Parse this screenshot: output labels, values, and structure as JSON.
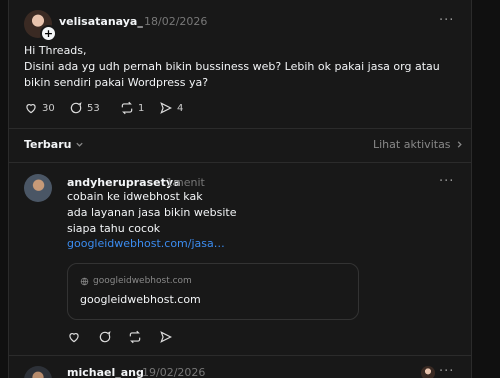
{
  "post": {
    "username": "velisatanaya_",
    "date": "18/02/2026",
    "text": "Hi Threads,\nDisini ada yg udh pernah bikin bussiness web? Lebih ok pakai jasa org atau bikin sendiri pakai Wordpress ya?",
    "likes": "30",
    "comments": "53",
    "reposts": "1",
    "shares": "4",
    "more_label": "···"
  },
  "replies_header": {
    "sort_label": "Terbaru",
    "activity_label": "Lihat aktivitas"
  },
  "reply1": {
    "username": "andyheruprasetya",
    "time": "1menit",
    "text": "cobain ke idwebhost kak\nada layanan jasa bikin website\nsiapa tahu cocok",
    "link": "googleidwebhost.com/jasa…",
    "preview_domain": "googleidwebhost.com",
    "preview_title": "googleidwebhost.com",
    "more_label": "···"
  },
  "reply2": {
    "username": "michael_ang",
    "date": "19/02/2026",
    "more_label": "···"
  },
  "colors": {
    "background": "#101010",
    "card": "#181818",
    "link": "#3b8cf0",
    "text": "#f3f5f7",
    "muted": "#777777"
  }
}
